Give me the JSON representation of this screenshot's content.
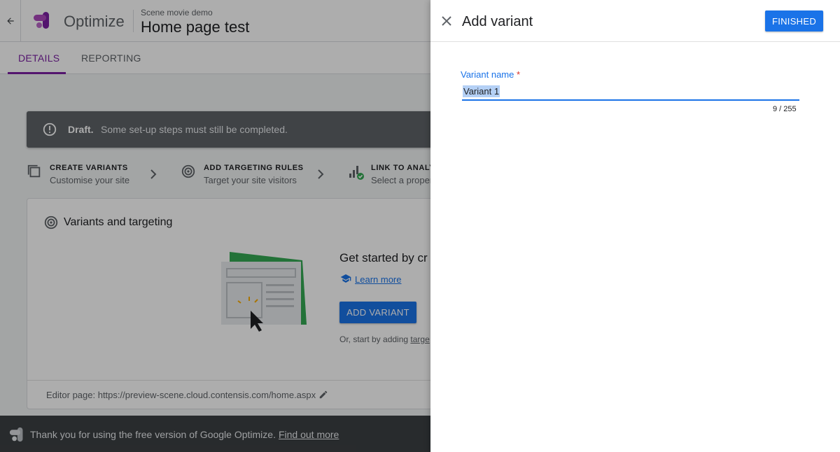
{
  "header": {
    "brand": "Optimize",
    "container_name": "Scene movie demo",
    "experiment_title": "Home page test"
  },
  "tabs": [
    {
      "label": "DETAILS",
      "active": true
    },
    {
      "label": "REPORTING",
      "active": false
    }
  ],
  "banner": {
    "strong": "Draft.",
    "text": "Some set-up steps must still be completed."
  },
  "steps": [
    {
      "title": "CREATE VARIANTS",
      "subtitle": "Customise your site",
      "icon": "copy-icon"
    },
    {
      "title": "ADD TARGETING RULES",
      "subtitle": "Target your site visitors",
      "icon": "target-icon"
    },
    {
      "title": "LINK TO ANALYT",
      "subtitle": "Select a propert",
      "icon": "analytics-check-icon"
    }
  ],
  "card": {
    "title": "Variants and targeting",
    "get_started": "Get started by cr",
    "learn_more": "Learn more",
    "add_variant": "ADD VARIANT",
    "or_text": "Or, start by adding ",
    "or_link": "targe",
    "editor_page": "Editor page: https://preview-scene.cloud.contensis.com/home.aspx"
  },
  "footer": {
    "text": "Thank you for using the free version of Google Optimize.",
    "link": "Find out more"
  },
  "panel": {
    "title": "Add variant",
    "finished_label": "FINISHED",
    "field_label": "Variant name",
    "required_mark": "*",
    "field_value": "Variant 1",
    "char_count": "9 / 255"
  },
  "colors": {
    "accent_blue": "#1a73e8",
    "tab_purple": "#7b1fa2",
    "banner_gray": "#5f6368",
    "footer_dark": "#3c4043",
    "required_red": "#d93025"
  }
}
